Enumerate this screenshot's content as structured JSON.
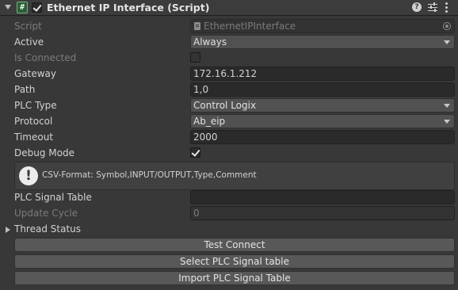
{
  "component": {
    "title": "Ethernet IP Interface (Script)",
    "enabled": true,
    "script_icon_glyph": "#"
  },
  "fields": {
    "script": {
      "label": "Script",
      "value": "EthernetIPInterface"
    },
    "active": {
      "label": "Active",
      "value": "Always"
    },
    "is_connected": {
      "label": "Is Connected",
      "checked": false
    },
    "gateway": {
      "label": "Gateway",
      "value": "172.16.1.212"
    },
    "path": {
      "label": "Path",
      "value": "1,0"
    },
    "plc_type": {
      "label": "PLC Type",
      "value": "Control Logix"
    },
    "protocol": {
      "label": "Protocol",
      "value": "Ab_eip"
    },
    "timeout": {
      "label": "Timeout",
      "value": "2000"
    },
    "debug_mode": {
      "label": "Debug Mode",
      "checked": true
    },
    "plc_signal_table": {
      "label": "PLC Signal Table",
      "value": ""
    },
    "update_cycle": {
      "label": "Update Cycle",
      "value": "0"
    }
  },
  "helpbox": {
    "icon_glyph": "!",
    "text": "CSV-Format: Symbol,INPUT/OUTPUT,Type,Comment"
  },
  "thread_status": {
    "label": "Thread Status"
  },
  "buttons": {
    "test_connect": "Test Connect",
    "select_table": "Select PLC Signal table",
    "import_table": "Import PLC Signal Table"
  },
  "colors": {
    "background": "#383838",
    "field": "#2a2a2a",
    "dropdown": "#515151",
    "button": "#585858",
    "script_icon": "#2f5a37"
  }
}
